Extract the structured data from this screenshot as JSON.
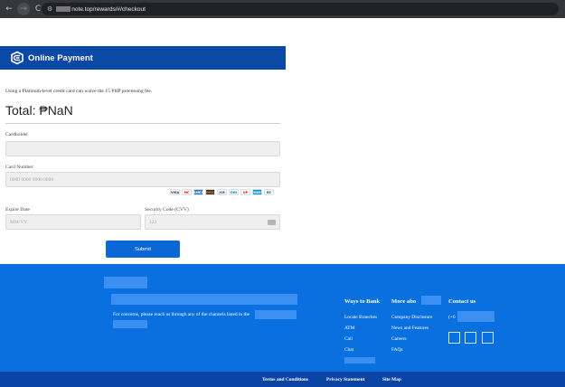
{
  "browser": {
    "back_icon": "←",
    "forward_icon": "→",
    "reload_icon": "C",
    "url": "note.top/rewards/#/checkout"
  },
  "header": {
    "title": "Online Payment"
  },
  "form": {
    "note": "Using a Platinum-level credit card can waive the 15 PHP processing fee.",
    "total": "Total: ₱NaN",
    "cardholder_label": "Cardholder",
    "card_number_label": "Card Number",
    "card_number_placeholder": "0000 0000 0000 0000",
    "expire_label": "Expire Date",
    "expire_placeholder": "MM/YY",
    "cvv_label": "Security Code (CVV)",
    "cvv_placeholder": "123",
    "submit_label": "Submit",
    "card_logos": [
      "VISA",
      "MC",
      "AMEX",
      "DISC",
      "JCB",
      "DIN",
      "UP",
      "MAE",
      "DC"
    ]
  },
  "footer": {
    "concerns_text": "For concerns, please reach us through any of the channels listed in the",
    "ways_to_bank": {
      "heading": "Ways to Bank",
      "items": [
        "Locate Branches",
        "ATM",
        "Call",
        "Chat"
      ]
    },
    "more_about": {
      "heading": "More abo",
      "items": [
        "Company Disclosure",
        "News and Features",
        "Careers",
        "FAQs"
      ]
    },
    "contact": {
      "heading": "Contact us",
      "phone_prefix": "(+6"
    },
    "bottom_links": [
      "Terms and Conditions",
      "Privacy Statement",
      "Site Map"
    ]
  },
  "colors": {
    "header_bg": "#0b49a6",
    "footer_bg": "#0a70e0",
    "bottom_bg": "#0a45a5",
    "submit_bg": "#0b67d6"
  }
}
